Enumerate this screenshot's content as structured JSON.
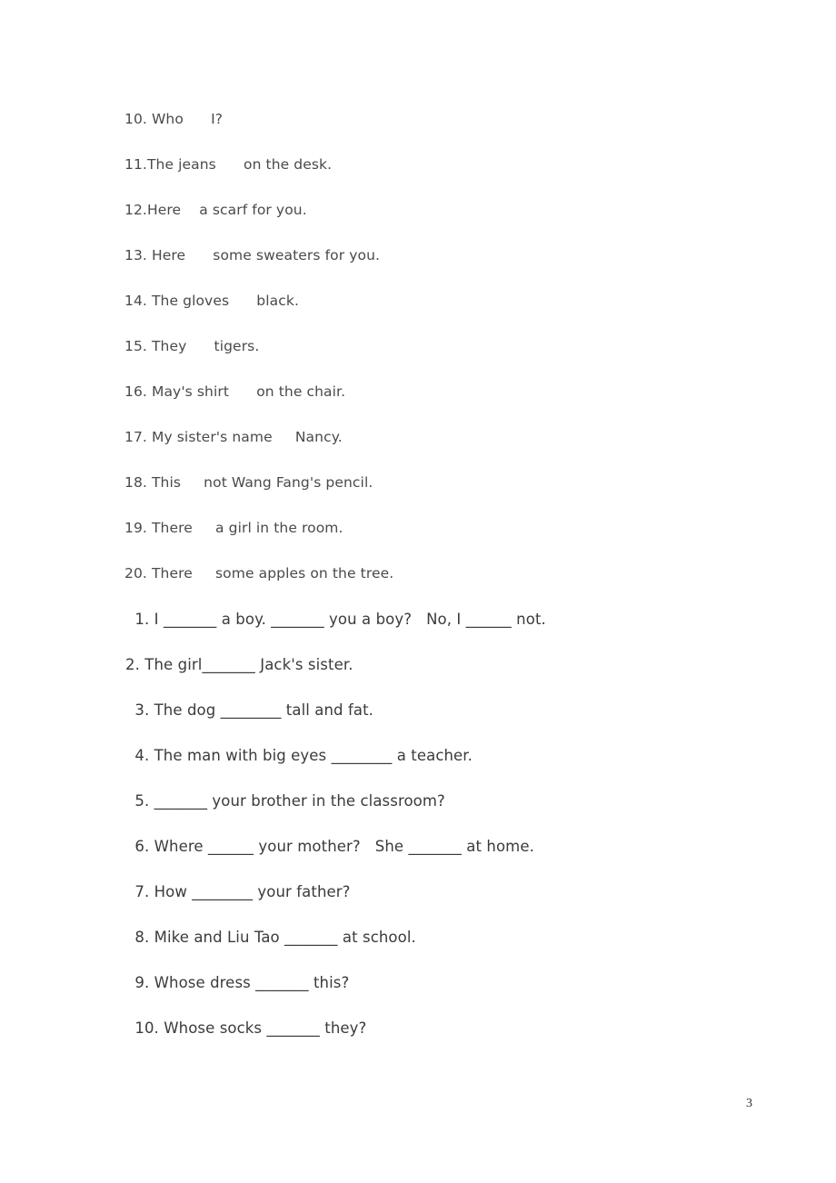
{
  "document": {
    "page_number": "3",
    "background_color": "#ffffff",
    "text_color": "#3a3a3a"
  },
  "section_one": {
    "style": "rounded-handwriting",
    "lines": [
      "10. Who      I?",
      "11.The jeans      on the desk.",
      "12.Here    a scarf for you.",
      "13. Here      some sweaters for you.",
      "14. The gloves      black.",
      "15. They      tigers.",
      "16. May's shirt      on the chair.",
      "17. My sister's name     Nancy.",
      "18. This     not Wang Fang's pencil.",
      "19. There     a girl in the room.",
      "20. There     some apples on the tree."
    ]
  },
  "section_two": {
    "style": "sans-with-underscore-blanks",
    "lines": [
      " 1. I _______ a boy. _______ you a boy?   No, I ______ not.",
      "2. The girl_______ Jack's sister.",
      " 3. The dog ________ tall and fat.",
      " 4. The man with big eyes ________ a teacher.",
      " 5. _______ your brother in the classroom?",
      " 6. Where ______ your mother?   She _______ at home.",
      " 7. How ________ your father?",
      " 8. Mike and Liu Tao _______ at school.",
      " 9. Whose dress _______ this?",
      " 10. Whose socks _______ they?"
    ]
  }
}
